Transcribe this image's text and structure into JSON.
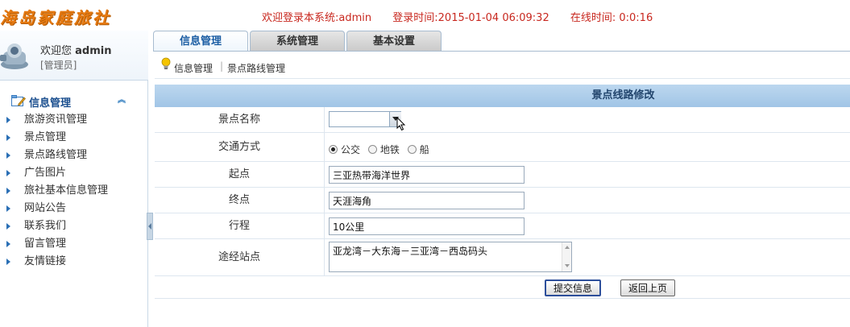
{
  "header": {
    "logo": "海岛家庭旅社",
    "welcome": "欢迎登录本系统:admin",
    "login_time": "登录时间:2015-01-04 06:09:32",
    "online_time": "在线时间: 0:0:16"
  },
  "user": {
    "greeting": "欢迎您",
    "name": "admin",
    "role": "[管理员]"
  },
  "sidebar": {
    "menu_title": "信息管理",
    "items": [
      {
        "label": "旅游资讯管理"
      },
      {
        "label": "景点管理"
      },
      {
        "label": "景点路线管理"
      },
      {
        "label": "广告图片"
      },
      {
        "label": "旅社基本信息管理"
      },
      {
        "label": "网站公告"
      },
      {
        "label": "联系我们"
      },
      {
        "label": "留言管理"
      },
      {
        "label": "友情链接"
      }
    ]
  },
  "tabs": [
    {
      "label": "信息管理",
      "active": true
    },
    {
      "label": "系统管理",
      "active": false
    },
    {
      "label": "基本设置",
      "active": false
    }
  ],
  "breadcrumb": {
    "level1": "信息管理",
    "level2": "景点路线管理"
  },
  "form": {
    "title": "景点线路修改",
    "scenic_name": {
      "label": "景点名称",
      "value": ""
    },
    "transport": {
      "label": "交通方式",
      "options": [
        {
          "label": "公交",
          "checked": true
        },
        {
          "label": "地铁",
          "checked": false
        },
        {
          "label": "船",
          "checked": false
        }
      ]
    },
    "start": {
      "label": "起点",
      "value": "三亚热带海洋世界"
    },
    "end": {
      "label": "终点",
      "value": "天涯海角"
    },
    "distance": {
      "label": "行程",
      "value": "10公里"
    },
    "stops": {
      "label": "途经站点",
      "value": "亚龙湾－大东海－三亚湾－西岛码头"
    },
    "submit_label": "提交信息",
    "back_label": "返回上页"
  },
  "colors": {
    "accent_blue": "#1b5da3",
    "header_red": "#c8281f",
    "logo_orange": "#e67a12",
    "form_title_bg": "#a1c5e6"
  }
}
